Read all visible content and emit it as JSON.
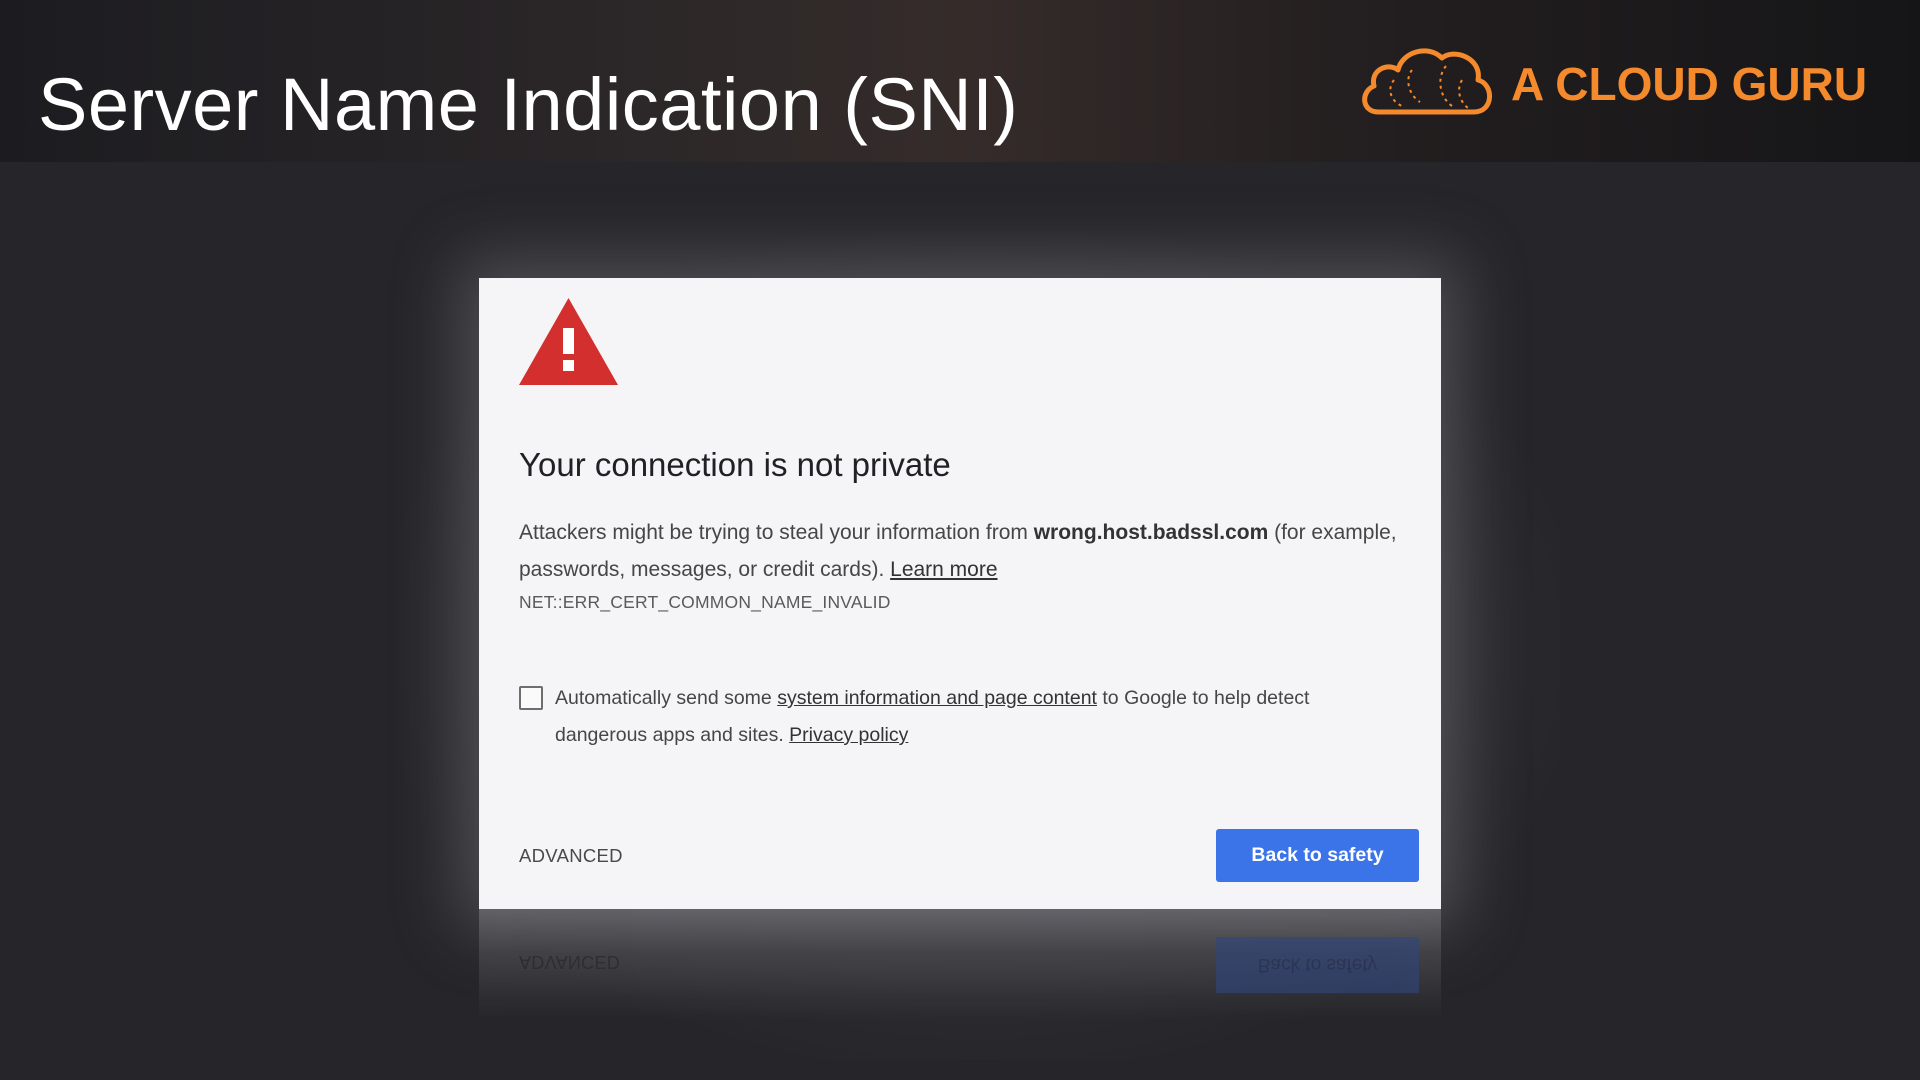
{
  "slide": {
    "title": "Server Name Indication (SNI)",
    "logo_text": "A CLOUD GURU"
  },
  "colors": {
    "brand_orange": "#f58a2d",
    "button_blue": "#3b73e8",
    "warning_red": "#d32f2f"
  },
  "dialog": {
    "icon": "warning-triangle-icon",
    "heading": "Your connection is not private",
    "body_prefix": "Attackers might be trying to steal your information from ",
    "host": "wrong.host.badssl.com",
    "body_suffix": " (for example, passwords, messages, or credit cards). ",
    "learn_more": "Learn more",
    "error_code": "NET::ERR_CERT_COMMON_NAME_INVALID",
    "checkbox_prefix": "Automatically send some ",
    "checkbox_link": "system information and page content",
    "checkbox_middle": " to Google to help detect dangerous apps and sites. ",
    "privacy_link": "Privacy policy",
    "advanced_label": "ADVANCED",
    "back_label": "Back to safety"
  }
}
